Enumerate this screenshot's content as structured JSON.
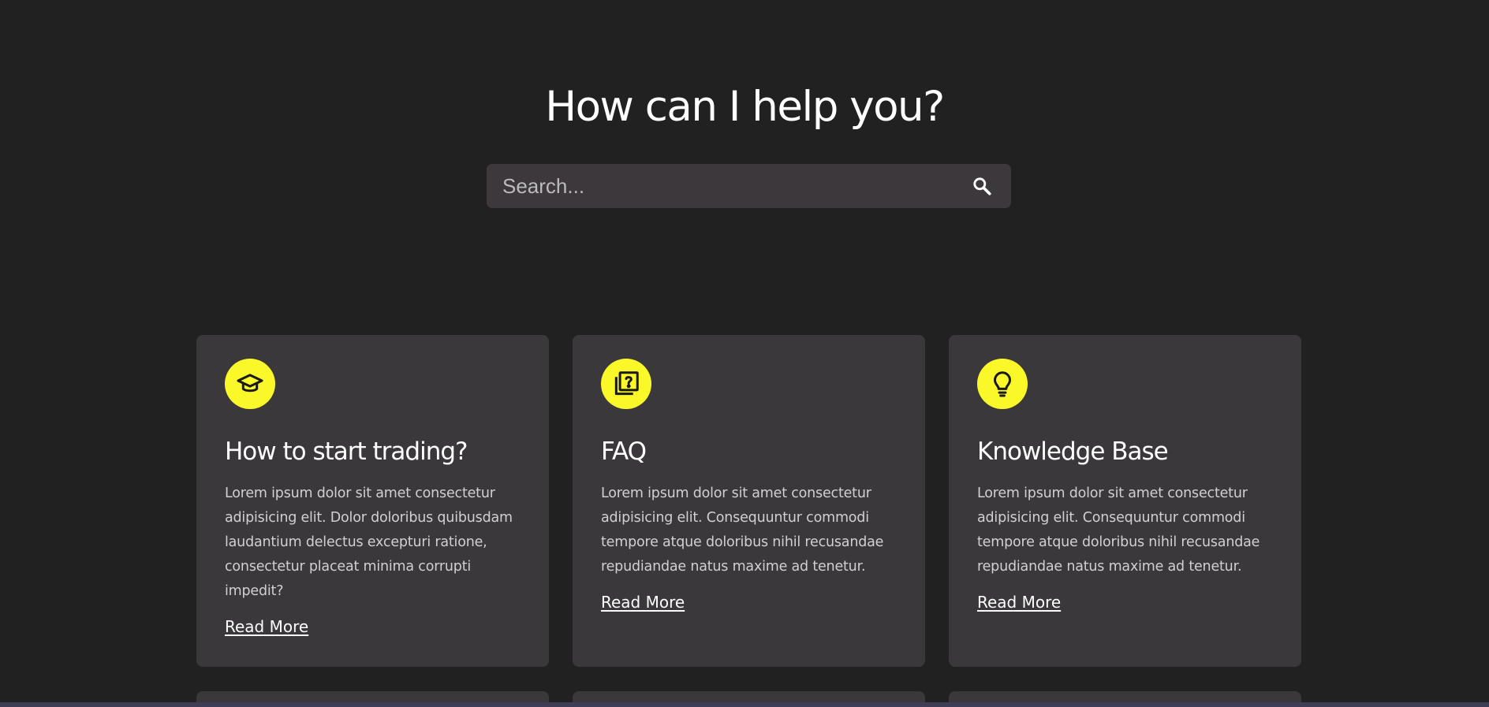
{
  "hero": {
    "title": "How can I help you?"
  },
  "search": {
    "placeholder": "Search...",
    "value": "",
    "icon": "search-icon"
  },
  "colors": {
    "background": "#212121",
    "card": "#3b383b",
    "accent": "#fbf82a"
  },
  "cards": [
    {
      "icon": "graduation-cap-icon",
      "title": "How to start trading?",
      "text": "Lorem ipsum dolor sit amet consectetur adipisicing elit. Dolor doloribus quibusdam laudantium delectus excepturi ratione, consectetur placeat minima corrupti impedit?",
      "link": "Read More"
    },
    {
      "icon": "question-library-icon",
      "title": "FAQ",
      "text": "Lorem ipsum dolor sit amet consectetur adipisicing elit. Consequuntur commodi tempore atque doloribus nihil recusandae repudiandae natus maxime ad tenetur.",
      "link": "Read More"
    },
    {
      "icon": "lightbulb-icon",
      "title": "Knowledge Base",
      "text": "Lorem ipsum dolor sit amet consectetur adipisicing elit. Consequuntur commodi tempore atque doloribus nihil recusandae repudiandae natus maxime ad tenetur.",
      "link": "Read More"
    }
  ]
}
